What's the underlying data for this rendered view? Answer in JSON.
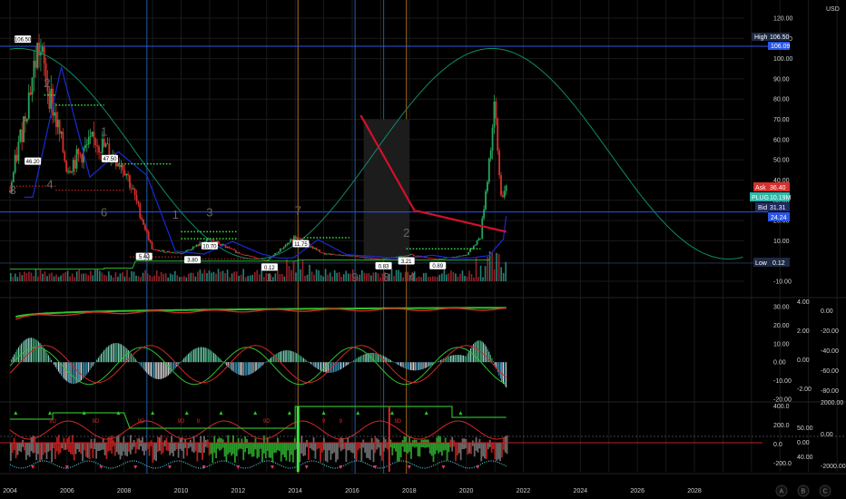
{
  "currency": "USD",
  "toolbar": {
    "a": "A",
    "b": "B",
    "c": "C"
  },
  "colors": {
    "background": "#000000",
    "up": "#26a65b",
    "down": "#d9302c",
    "grid": "#1a1a1a",
    "hline": "#2b55e6",
    "vline_blue": "#1b4f8a",
    "vline_orange": "#8a5a1b",
    "ma_red": "#d2102a",
    "ma_green": "#0f8a6a",
    "ma_blue": "#1a2ad0",
    "cyan": "#4fd0e0",
    "dotted_green": "#3ee03e"
  },
  "price_levels": {
    "high": {
      "label": "High",
      "value": "106.50"
    },
    "line_top": {
      "value": "106.09"
    },
    "ask": {
      "label": "Ask",
      "value": "36.40"
    },
    "plug": {
      "label": "PLUG",
      "value": "10.19M"
    },
    "bid": {
      "label": "Bid",
      "value": "31.31"
    },
    "line_low": {
      "value": "24.24"
    },
    "low": {
      "label": "Low",
      "value": "0.12"
    }
  },
  "annotations": [
    {
      "text": "106.50"
    },
    {
      "text": "46.20"
    },
    {
      "text": "47.50"
    },
    {
      "text": "5.40"
    },
    {
      "text": "3.80"
    },
    {
      "text": "10.70"
    },
    {
      "text": "0.12"
    },
    {
      "text": "11.75"
    },
    {
      "text": "0.83"
    },
    {
      "text": "3.21"
    },
    {
      "text": "0.89"
    }
  ],
  "wave_counts": [
    {
      "text": "3"
    },
    {
      "text": "2"
    },
    {
      "text": "4"
    },
    {
      "text": "1"
    },
    {
      "text": "6"
    },
    {
      "text": "9"
    },
    {
      "text": "1"
    },
    {
      "text": "3"
    },
    {
      "text": "1"
    },
    {
      "text": "7"
    },
    {
      "text": "9"
    },
    {
      "text": "8"
    },
    {
      "text": "2"
    },
    {
      "text": "4"
    }
  ],
  "chart_data": [
    {
      "type": "line",
      "title": "",
      "x": [
        2004,
        2005,
        2006,
        2007,
        2008,
        2009,
        2010,
        2011,
        2012,
        2013,
        2014,
        2015,
        2016,
        2017,
        2018,
        2019,
        2020,
        2020.5,
        2021,
        2021.2
      ],
      "series": [
        {
          "values": [
            35,
            106.5,
            46,
            60,
            47,
            5.4,
            3.8,
            10.7,
            4,
            0.12,
            11.75,
            3.5,
            2.5,
            0.83,
            3.21,
            0.89,
            3,
            12,
            75,
            34
          ]
        }
      ],
      "xticks": [
        "2004",
        "2006",
        "2008",
        "2010",
        "2012",
        "2014",
        "2016",
        "2018",
        "2020",
        "2022",
        "2024",
        "2026",
        "2028"
      ],
      "yticks": [
        "120.00",
        "110.00",
        "100.00",
        "90.00",
        "80.00",
        "70.00",
        "60.00",
        "50.00",
        "40.00",
        "30.00",
        "20.00",
        "10.00",
        "-10.00"
      ],
      "ylim": [
        -15,
        125
      ]
    },
    {
      "type": "bar",
      "title": "",
      "yticks_left": [
        "30.00",
        "20.00",
        "10.00",
        "0.00",
        "-10.00",
        "-20.00"
      ],
      "yticks_mid": [
        "4.00",
        "2.00",
        "0.00",
        "-2.00"
      ],
      "yticks_right": [
        "0.00",
        "-20.00",
        "-40.00",
        "-60.00",
        "-80.00"
      ]
    },
    {
      "type": "bar",
      "title": "",
      "yticks_left": [
        "400.0",
        "200.0",
        "0.0",
        "-200.0"
      ],
      "yticks_mid": [
        "50.00",
        "0.00",
        "40.00"
      ],
      "yticks_right": [
        "2000.00",
        "0.00",
        "-2000.00"
      ],
      "labels": [
        "9D",
        "9D",
        "9D",
        "9D",
        "9",
        "9D",
        "9",
        "9",
        "9D"
      ]
    }
  ]
}
